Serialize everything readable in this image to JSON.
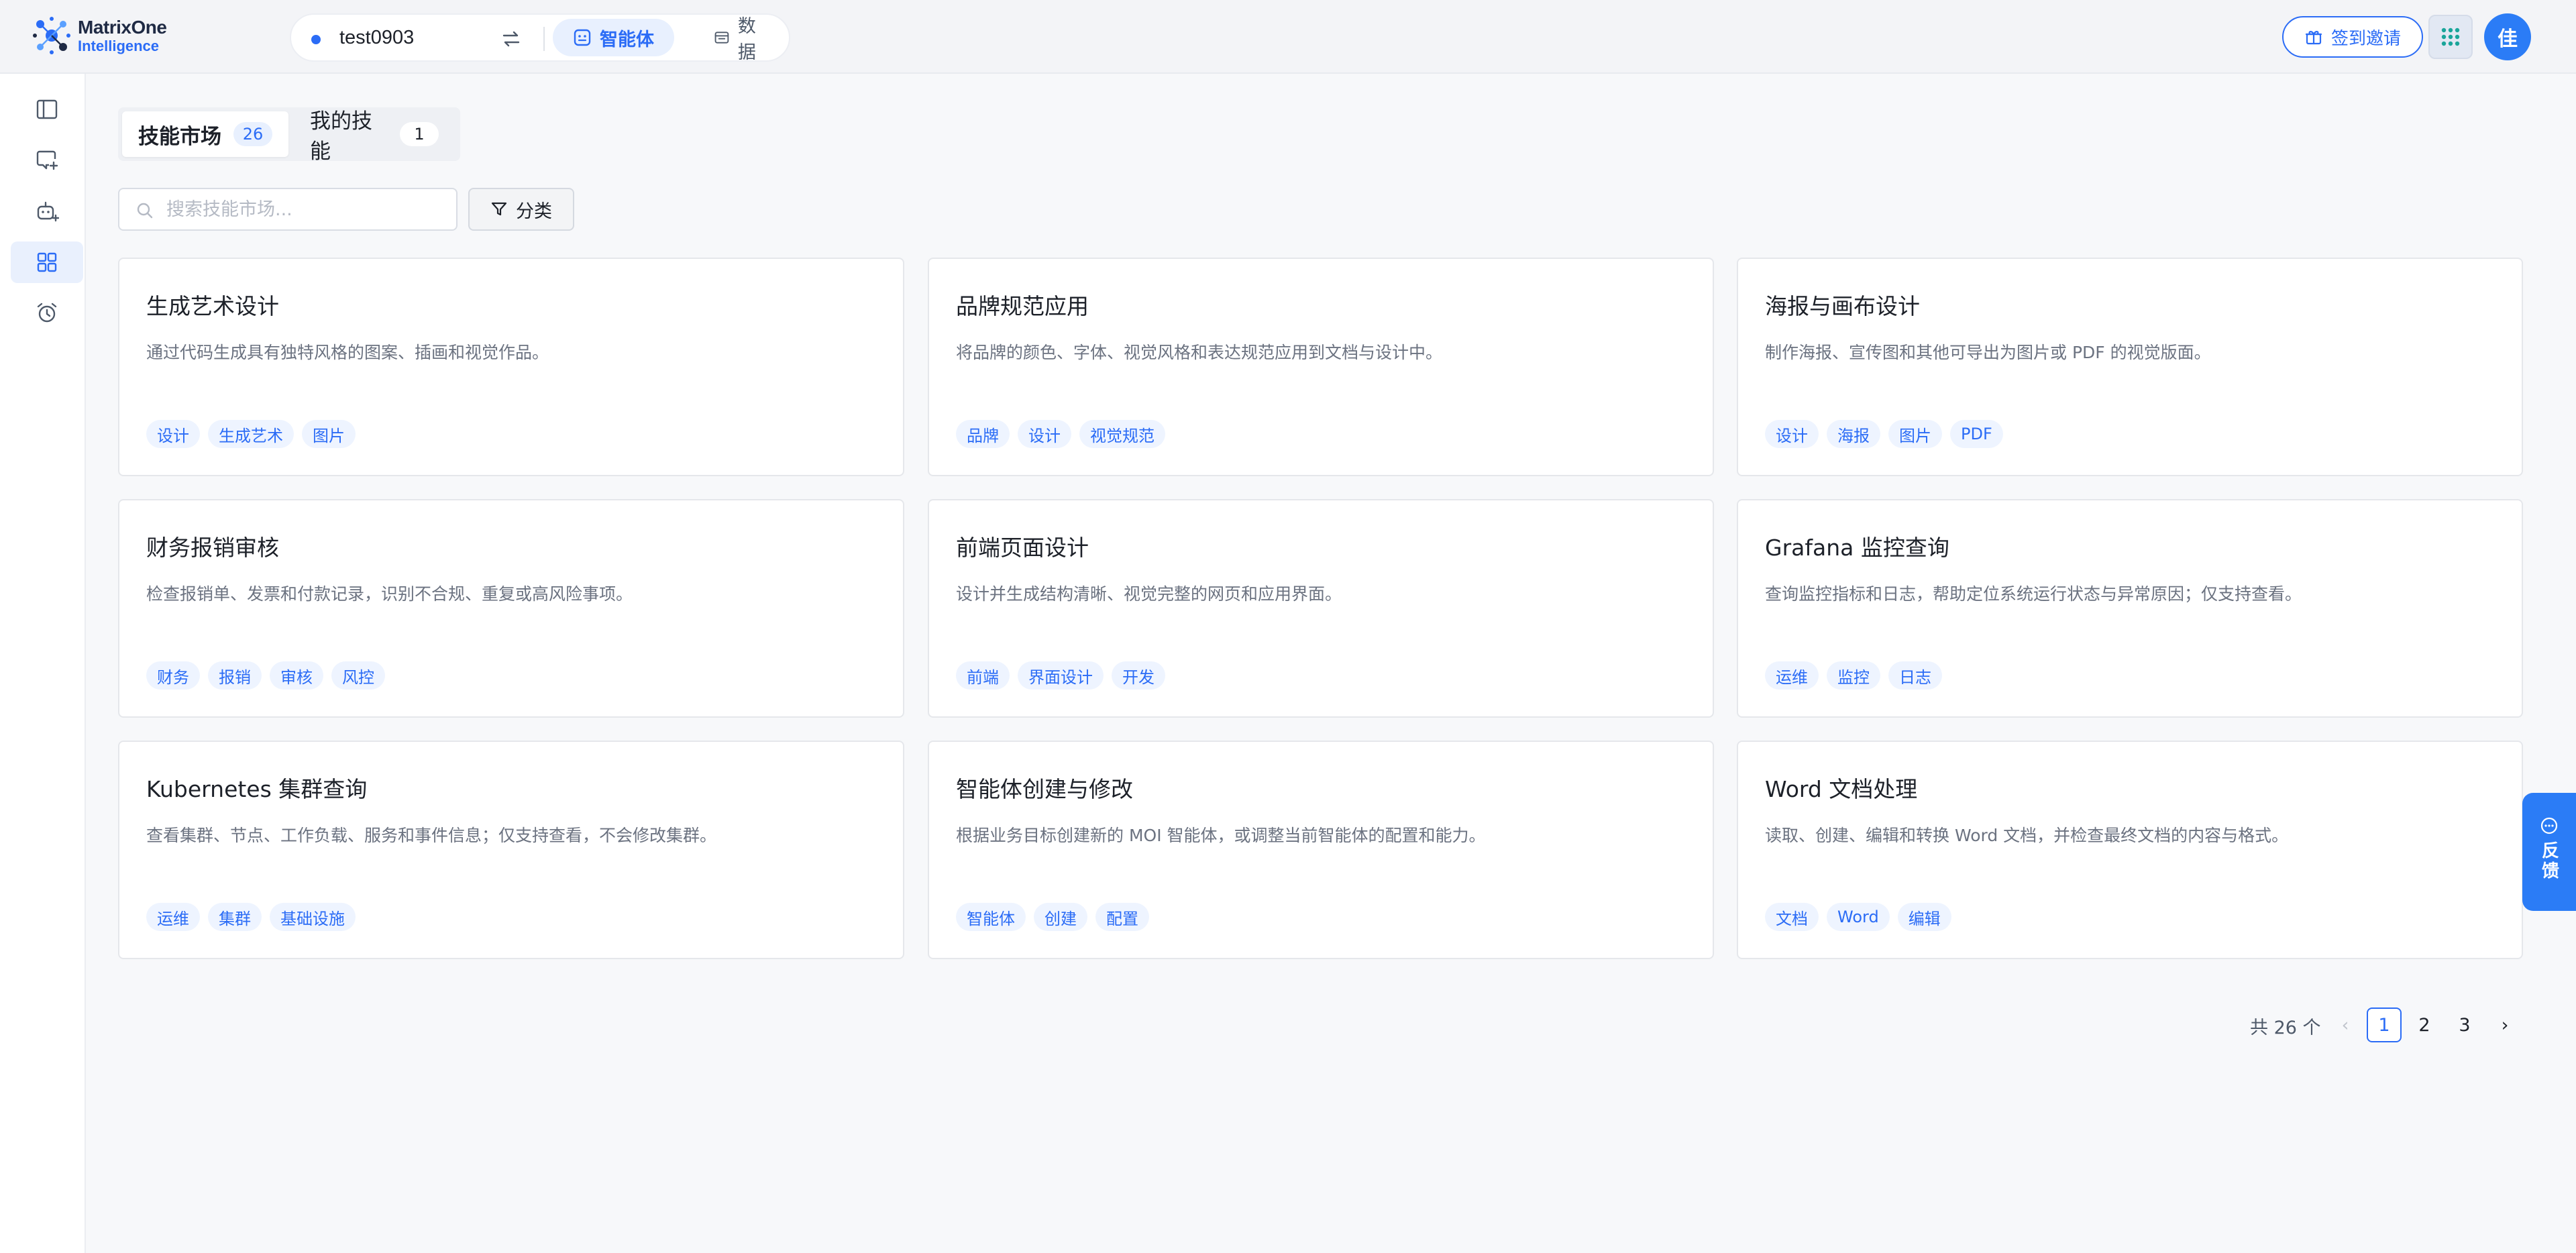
{
  "logo": {
    "line1": "MatrixOne",
    "line2": "Intelligence"
  },
  "workspace": {
    "name": "test0903"
  },
  "header_tabs": [
    {
      "label": "智能体",
      "icon": "agent-icon",
      "active": true
    },
    {
      "label": "数据",
      "icon": "data-icon",
      "active": false
    }
  ],
  "header_right": {
    "invite_label": "签到邀请",
    "apps_icon": "grid-icon",
    "avatar_text": "佳"
  },
  "sidebar": {
    "items": [
      {
        "icon": "sidebar-toggle-icon",
        "active": false
      },
      {
        "icon": "new-chat-icon",
        "active": false
      },
      {
        "icon": "robot-add-icon",
        "active": false
      },
      {
        "icon": "skills-grid-icon",
        "active": true
      },
      {
        "icon": "alarm-clock-icon",
        "active": false
      }
    ]
  },
  "tabs": {
    "market": {
      "label": "技能市场",
      "count": "26"
    },
    "mine": {
      "label": "我的技能",
      "count": "1"
    }
  },
  "search": {
    "placeholder": "搜索技能市场..."
  },
  "filter": {
    "label": "分类"
  },
  "cards": [
    {
      "title": "生成艺术设计",
      "desc": "通过代码生成具有独特风格的图案、插画和视觉作品。",
      "tags": [
        "设计",
        "生成艺术",
        "图片"
      ]
    },
    {
      "title": "品牌规范应用",
      "desc": "将品牌的颜色、字体、视觉风格和表达规范应用到文档与设计中。",
      "tags": [
        "品牌",
        "设计",
        "视觉规范"
      ]
    },
    {
      "title": "海报与画布设计",
      "desc": "制作海报、宣传图和其他可导出为图片或 PDF 的视觉版面。",
      "tags": [
        "设计",
        "海报",
        "图片",
        "PDF"
      ]
    },
    {
      "title": "财务报销审核",
      "desc": "检查报销单、发票和付款记录，识别不合规、重复或高风险事项。",
      "tags": [
        "财务",
        "报销",
        "审核",
        "风控"
      ]
    },
    {
      "title": "前端页面设计",
      "desc": "设计并生成结构清晰、视觉完整的网页和应用界面。",
      "tags": [
        "前端",
        "界面设计",
        "开发"
      ]
    },
    {
      "title": "Grafana 监控查询",
      "desc": "查询监控指标和日志，帮助定位系统运行状态与异常原因；仅支持查看。",
      "tags": [
        "运维",
        "监控",
        "日志"
      ]
    },
    {
      "title": "Kubernetes 集群查询",
      "desc": "查看集群、节点、工作负载、服务和事件信息；仅支持查看，不会修改集群。",
      "tags": [
        "运维",
        "集群",
        "基础设施"
      ]
    },
    {
      "title": "智能体创建与修改",
      "desc": "根据业务目标创建新的 MOI 智能体，或调整当前智能体的配置和能力。",
      "tags": [
        "智能体",
        "创建",
        "配置"
      ]
    },
    {
      "title": "Word 文档处理",
      "desc": "读取、创建、编辑和转换 Word 文档，并检查最终文档的内容与格式。",
      "tags": [
        "文档",
        "Word",
        "编辑"
      ]
    }
  ],
  "pagination": {
    "total_label": "共 26 个",
    "pages": [
      "1",
      "2",
      "3"
    ],
    "current": "1",
    "prev": "‹",
    "next": "›"
  },
  "feedback": {
    "label": "反馈"
  }
}
